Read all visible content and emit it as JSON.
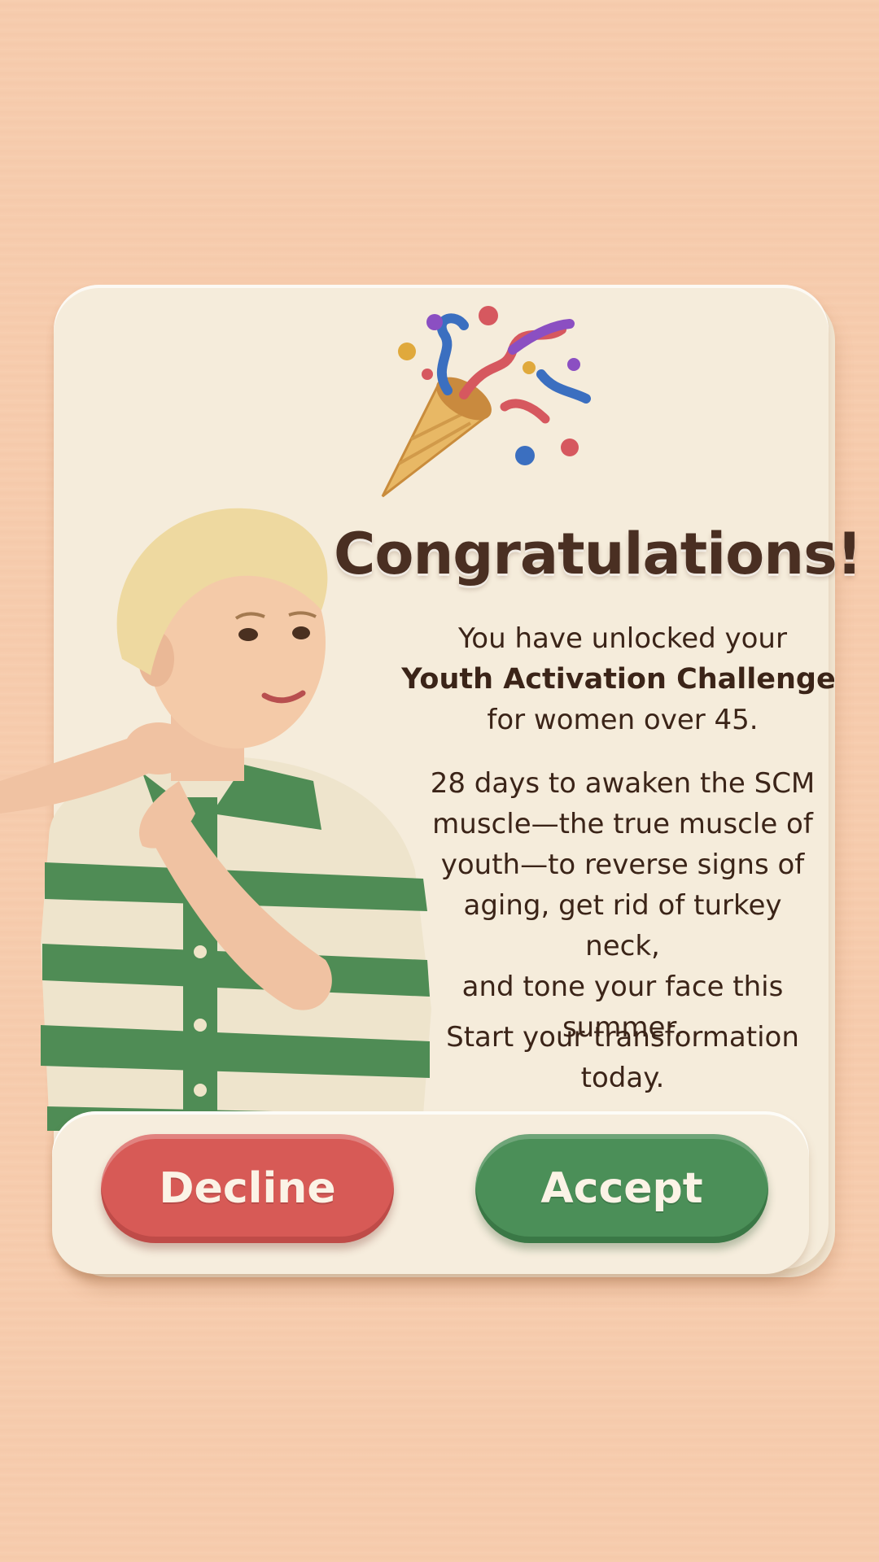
{
  "dialog": {
    "headline": "Congratulations!",
    "intro_line1": "You have unlocked your",
    "intro_line2": "Youth Activation Challenge",
    "intro_line3": "for women over 45.",
    "body_line1": "28 days to awaken the SCM",
    "body_line2": "muscle—the true muscle of",
    "body_line3": "youth—to reverse signs of",
    "body_line4": "aging, get rid of turkey neck,",
    "body_line5": "and tone your face this",
    "body_line6": "summer.",
    "cta_line1": "Start your transformation",
    "cta_line2": "today."
  },
  "buttons": {
    "decline_label": "Decline",
    "accept_label": "Accept"
  },
  "icons": {
    "celebration": "party-popper-icon",
    "illustration": "woman-touching-neck-illustration"
  },
  "colors": {
    "background": "#f7ceb0",
    "card": "#f5ecdb",
    "headline": "#4a2f22",
    "decline": "#d75a56",
    "accept": "#4b8f58"
  }
}
